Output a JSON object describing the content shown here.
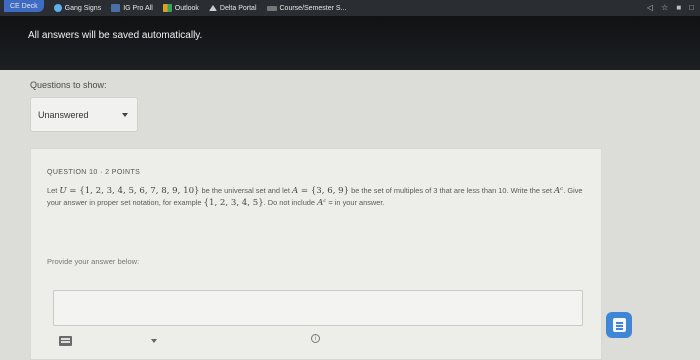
{
  "browser": {
    "bookmarks": [
      {
        "label": "CE Deck",
        "icon": "folder-icon",
        "color": "#3e6cc4"
      },
      {
        "label": "Gang Signs",
        "icon": "circle-c-icon",
        "color": "#5fb0e6"
      },
      {
        "label": "IG Pro All",
        "icon": "folder-icon",
        "color": "#4a6fa8"
      },
      {
        "label": "Outlook",
        "icon": "grid-icon",
        "color": "#e0a020"
      },
      {
        "label": "Delta Portal",
        "icon": "triangle-icon",
        "color": "#cfcfcf"
      },
      {
        "label": "Course/Semester S...",
        "icon": "dsl-icon",
        "color": "#bdbdbd"
      }
    ]
  },
  "notice": {
    "text": "All answers will be saved automatically."
  },
  "filter": {
    "label": "Questions to show:",
    "selected": "Unanswered"
  },
  "question": {
    "number": "QUESTION 10",
    "separator": "·",
    "points": "2 POINTS",
    "t1": "Let ",
    "U": "U",
    "t2": " = ",
    "setU": "{1, 2, 3, 4, 5, 6, 7, 8, 9, 10}",
    "t3": " be the universal set and let ",
    "A": "A",
    "t4": " = ",
    "setA": "{3, 6, 9}",
    "t5": " be the set of multiples of 3 that are less than 10. Write the set ",
    "Ac": "Aᶜ",
    "t6": ". Give your answer in proper set notation, for example ",
    "example": "{1, 2, 3, 4, 5}",
    "t7": ". Do not include ",
    "Ac2": "Aᶜ",
    "t8": " = in your answer.",
    "prompt": "Provide your answer below:",
    "answer_value": ""
  },
  "colors": {
    "accent": "#3f86d6",
    "header_bg": "#15181b"
  }
}
